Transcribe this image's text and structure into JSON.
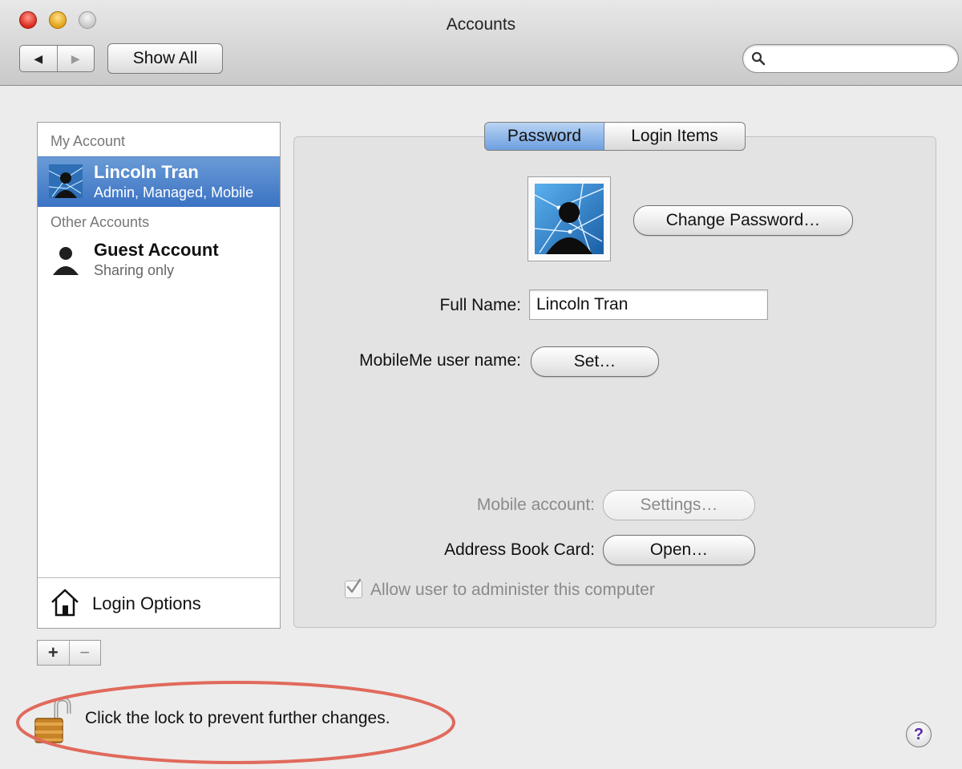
{
  "window": {
    "title": "Accounts"
  },
  "toolbar": {
    "back_glyph": "◀",
    "forward_glyph": "▶",
    "show_all_label": "Show All",
    "search_placeholder": "",
    "search_icon": "search-icon"
  },
  "sidebar": {
    "my_account_header": "My Account",
    "other_accounts_header": "Other Accounts",
    "accounts": [
      {
        "name": "Lincoln Tran",
        "detail": "Admin, Managed, Mobile",
        "selected": true,
        "icon": "user-network-avatar-icon"
      },
      {
        "name": "Guest Account",
        "detail": "Sharing only",
        "selected": false,
        "icon": "person-silhouette-icon"
      }
    ],
    "login_options_label": "Login Options",
    "add_glyph": "+",
    "remove_glyph": "−"
  },
  "tabs": {
    "password_label": "Password",
    "login_items_label": "Login Items",
    "active": "Password"
  },
  "form": {
    "change_password_label": "Change Password…",
    "full_name_label": "Full Name:",
    "full_name_value": "Lincoln Tran",
    "mobileme_label": "MobileMe user name:",
    "set_label": "Set…",
    "mobile_account_label": "Mobile account:",
    "settings_label": "Settings…",
    "address_book_label": "Address Book Card:",
    "open_label": "Open…",
    "allow_admin_label": "Allow user to administer this computer",
    "allow_admin_checked": true
  },
  "footer": {
    "lock_message": "Click the lock to prevent further changes.",
    "help_glyph": "?"
  },
  "colors": {
    "selection": "#3b73c4",
    "annotation_circle": "#e06a5c",
    "help_mark": "#5a2aa0"
  }
}
